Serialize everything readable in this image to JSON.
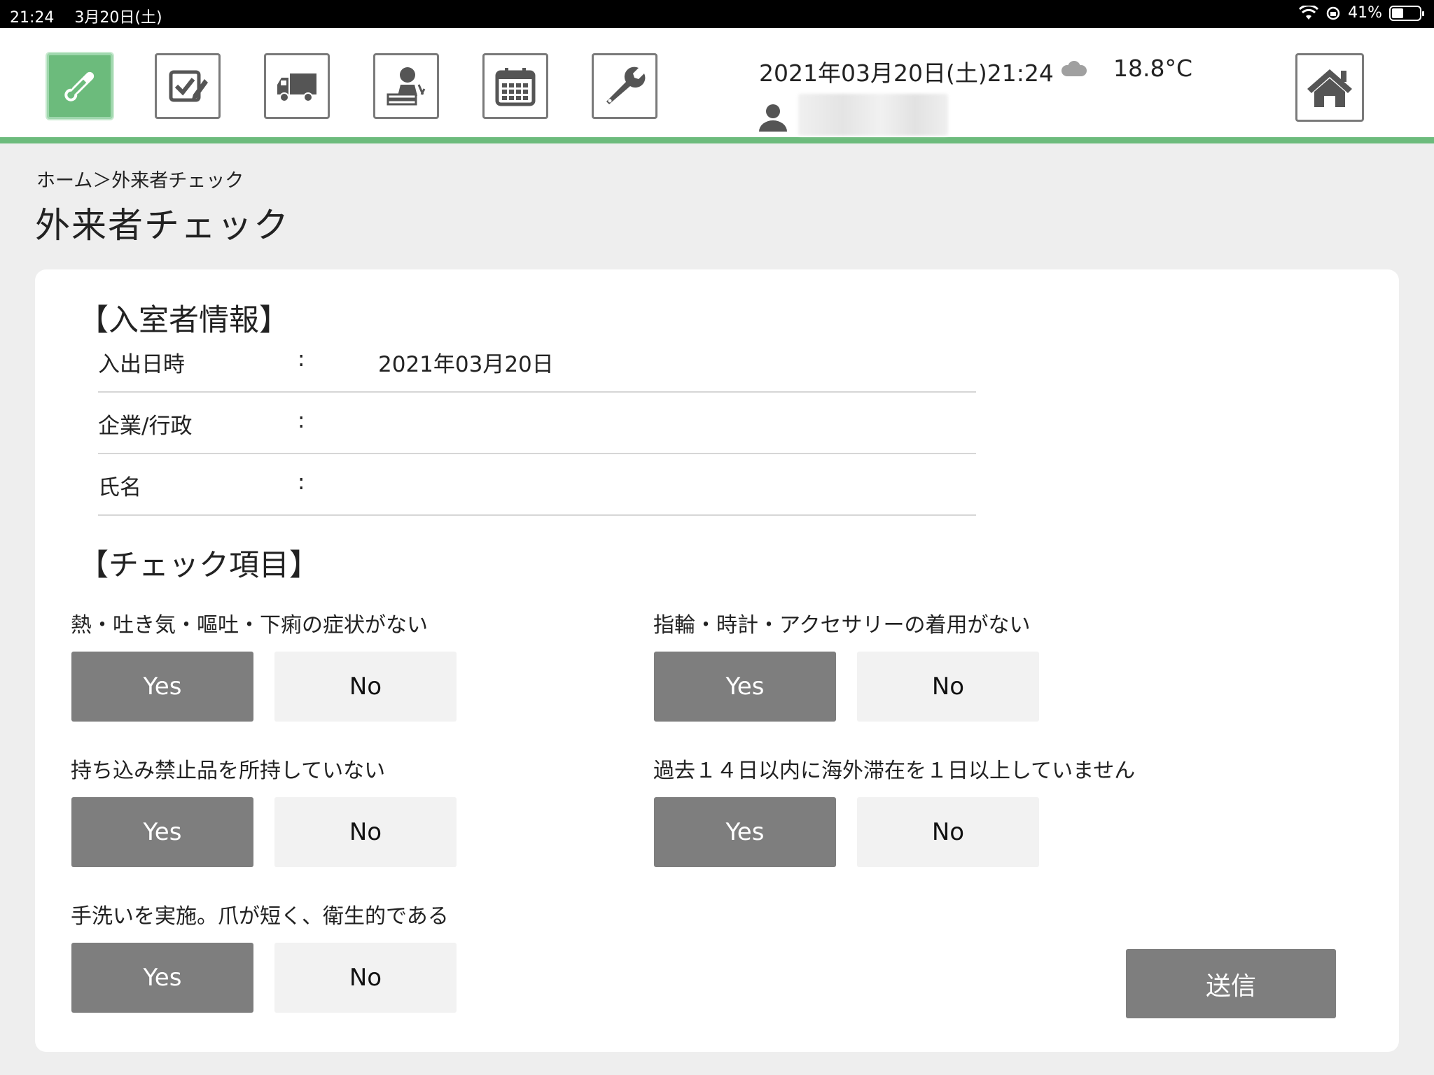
{
  "status_bar": {
    "time": "21:24",
    "date": "3月20日(土)",
    "battery": "41%"
  },
  "header": {
    "datetime": "2021年03月20日(土)21:24",
    "temperature": "18.8°C"
  },
  "toolbar": {
    "buttons": [
      {
        "name": "thermometer-icon"
      },
      {
        "name": "checklist-icon"
      },
      {
        "name": "truck-icon"
      },
      {
        "name": "visitor-desk-icon"
      },
      {
        "name": "calendar-icon"
      },
      {
        "name": "wrench-icon"
      }
    ],
    "active_index": 0
  },
  "breadcrumb": "ホーム＞外来者チェック",
  "page_title": "外来者チェック",
  "entry_info": {
    "title": "【入室者情報】",
    "rows": [
      {
        "label": "入出日時",
        "colon": ":",
        "value": "2021年03月20日"
      },
      {
        "label": "企業/行政",
        "colon": ":",
        "value": ""
      },
      {
        "label": "氏名",
        "colon": ":",
        "value": ""
      }
    ]
  },
  "check_items": {
    "title": "【チェック項目】",
    "yes_label": "Yes",
    "no_label": "No",
    "items": [
      {
        "question": "熱・吐き気・嘔吐・下痢の症状がない",
        "selected": "Yes"
      },
      {
        "question": "指輪・時計・アクセサリーの着用がない",
        "selected": "Yes"
      },
      {
        "question": "持ち込み禁止品を所持していない",
        "selected": "Yes"
      },
      {
        "question": "過去１４日以内に海外滞在を１日以上していません",
        "selected": "Yes"
      },
      {
        "question": "手洗いを実施。爪が短く、衛生的である",
        "selected": "Yes"
      }
    ]
  },
  "submit_label": "送信",
  "colors": {
    "accent_green": "#6cbb7c",
    "selected_gray": "#7e7e7e"
  }
}
